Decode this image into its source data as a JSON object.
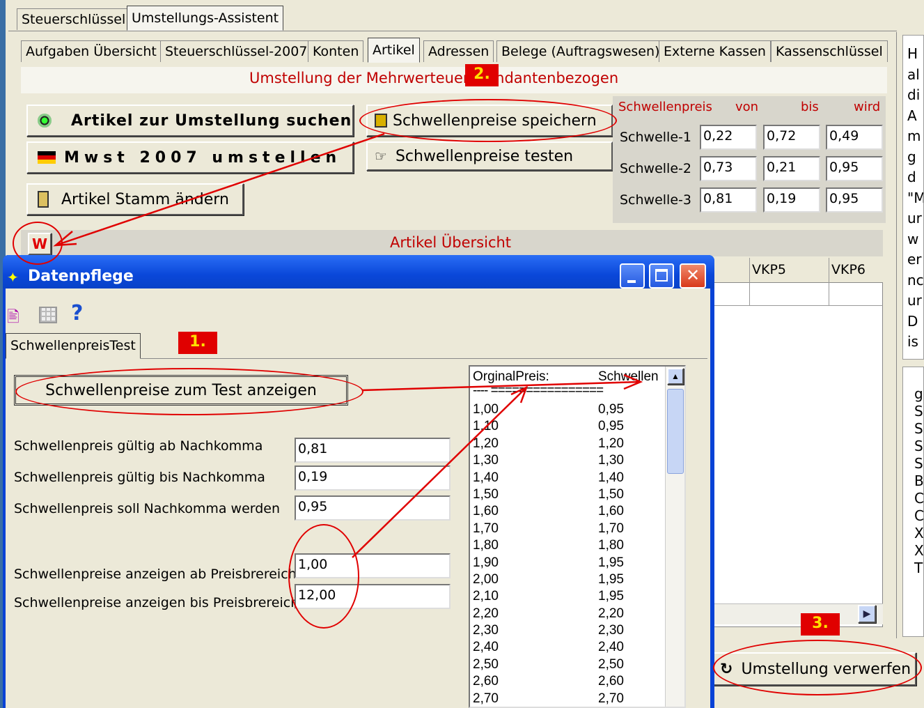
{
  "top_tabs": [
    "Steuerschlüssel",
    "Umstellungs-Assistent"
  ],
  "sub_tabs": [
    "Aufgaben Übersicht",
    "Steuerschlüssel-2007",
    "Konten",
    "Artikel",
    "Adressen",
    "Belege (Auftragswesen)",
    "Externe Kassen",
    "Kassenschlüssel"
  ],
  "panel_header": "Umstellung der Mehrwerteuer Mandantenbezogen",
  "buttons": {
    "search": "Artikel zur Umstellung suchen",
    "mwst": "Mwst 2007 umstellen",
    "stamm": "Artikel Stamm ändern",
    "save_thresholds": "Schwellenpreise speichern",
    "test_thresholds": "Schwellenpreise testen",
    "w": "W",
    "discard": "Umstellung verwerfen"
  },
  "threshold_table": {
    "headers": [
      "Schwellenpreis",
      "von",
      "bis",
      "wird"
    ],
    "rows": [
      {
        "label": "Schwelle-1",
        "von": "0,22",
        "bis": "0,72",
        "wird": "0,49"
      },
      {
        "label": "Schwelle-2",
        "von": "0,73",
        "bis": "0,21",
        "wird": "0,95"
      },
      {
        "label": "Schwelle-3",
        "von": "0,81",
        "bis": "0,19",
        "wird": "0,95"
      }
    ]
  },
  "article_overview": "Artikel Übersicht",
  "grid_cols": [
    "VKP5",
    "VKP6"
  ],
  "right_text": [
    "H",
    "al",
    "di",
    "A",
    "m",
    "g",
    "d",
    "\"M",
    "ur",
    "w",
    "er",
    "nc",
    "ur",
    "D",
    "is"
  ],
  "right_text2": [
    "g",
    "S",
    "S",
    "S",
    "S",
    "B",
    "C",
    "C",
    "X",
    "X",
    "T"
  ],
  "annotations": {
    "one": "1.",
    "two": "2.",
    "three": "3."
  },
  "dialog": {
    "title": "Datenpflege",
    "tab": "SchwellenpreisTest",
    "show_button": "Schwellenpreise zum Test anzeigen",
    "fields": [
      {
        "label": "Schwellenpreis gültig ab Nachkomma",
        "value": "0,81"
      },
      {
        "label": "Schwellenpreis gültig bis Nachkomma",
        "value": "0,19"
      },
      {
        "label": "Schwellenpreis soll Nachkomma werden",
        "value": "0,95"
      },
      {
        "label": "Schwellenpreise anzeigen ab Preisbrereich",
        "value": "1,00"
      },
      {
        "label": "Schwellenpreise anzeigen bis Preisbrereich",
        "value": "12,00"
      }
    ],
    "list_header": {
      "col1": "OrginalPreis:",
      "col2": "Schwellen",
      "sep": "----  ================"
    },
    "list_rows": [
      [
        "1,00",
        "0,95"
      ],
      [
        "1,10",
        "0,95"
      ],
      [
        "1,20",
        "1,20"
      ],
      [
        "1,30",
        "1,30"
      ],
      [
        "1,40",
        "1,40"
      ],
      [
        "1,50",
        "1,50"
      ],
      [
        "1,60",
        "1,60"
      ],
      [
        "1,70",
        "1,70"
      ],
      [
        "1,80",
        "1,80"
      ],
      [
        "1,90",
        "1,95"
      ],
      [
        "2,00",
        "1,95"
      ],
      [
        "2,10",
        "1,95"
      ],
      [
        "2,20",
        "2,20"
      ],
      [
        "2,30",
        "2,30"
      ],
      [
        "2,40",
        "2,40"
      ],
      [
        "2,50",
        "2,50"
      ],
      [
        "2,60",
        "2,60"
      ],
      [
        "2,70",
        "2,70"
      ]
    ]
  },
  "colors": {
    "accent_red": "#e00000",
    "title_blue": "#0a3fc2",
    "badge_yellow": "#ffe000"
  }
}
